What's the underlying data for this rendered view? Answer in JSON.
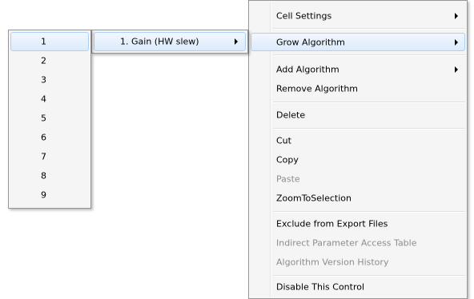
{
  "number_menu": {
    "items": [
      "1",
      "2",
      "3",
      "4",
      "5",
      "6",
      "7",
      "8",
      "9"
    ],
    "selected": "1"
  },
  "algorithm_menu": {
    "items": [
      {
        "label": "1. Gain (HW slew)",
        "submenu": true
      }
    ]
  },
  "context_menu": {
    "items": [
      {
        "label": "Cell Settings",
        "submenu": true,
        "disabled": false
      },
      {
        "label": "Grow Algorithm",
        "submenu": true,
        "disabled": false
      },
      {
        "label": "Add Algorithm",
        "submenu": true,
        "disabled": false
      },
      {
        "label": "Remove Algorithm",
        "submenu": false,
        "disabled": false
      },
      {
        "label": "Delete",
        "submenu": false,
        "disabled": false
      },
      {
        "label": "Cut",
        "submenu": false,
        "disabled": false
      },
      {
        "label": "Copy",
        "submenu": false,
        "disabled": false
      },
      {
        "label": "Paste",
        "submenu": false,
        "disabled": true
      },
      {
        "label": "ZoomToSelection",
        "submenu": false,
        "disabled": false
      },
      {
        "label": "Exclude from Export Files",
        "submenu": false,
        "disabled": false
      },
      {
        "label": "Indirect Parameter Access Table",
        "submenu": false,
        "disabled": true
      },
      {
        "label": "Algorithm Version History",
        "submenu": false,
        "disabled": true
      },
      {
        "label": "Disable This Control",
        "submenu": false,
        "disabled": false
      }
    ]
  }
}
